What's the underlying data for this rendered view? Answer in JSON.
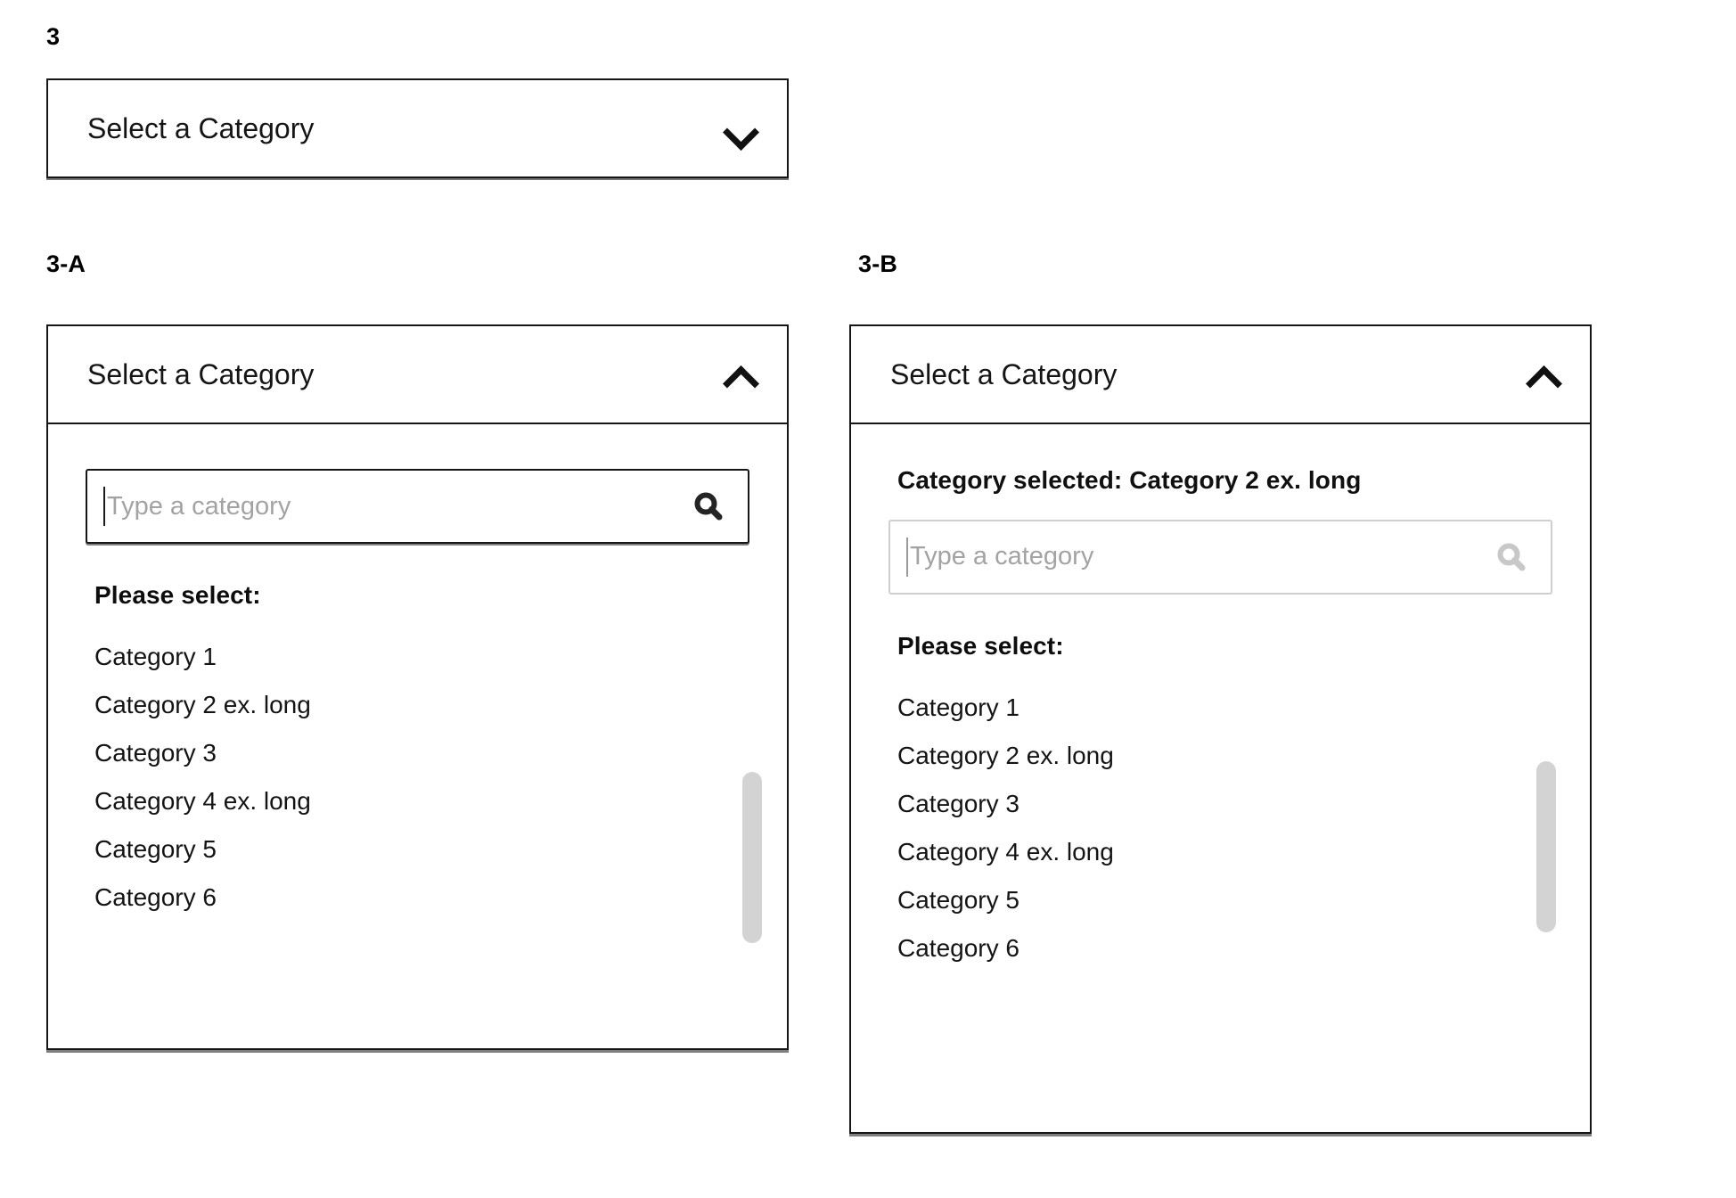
{
  "sections": {
    "collapsed": {
      "label": "3"
    },
    "variant_a": {
      "label": "3-A"
    },
    "variant_b": {
      "label": "3-B"
    }
  },
  "select_collapsed": {
    "placeholder": "Select a Category",
    "chevron_icon": "chevron-down-icon"
  },
  "dropdown_a": {
    "header_label": "Select a Category",
    "chevron_icon": "chevron-up-icon",
    "search": {
      "value": "",
      "placeholder": "Type a category",
      "icon": "search-icon",
      "state": "active",
      "border_color": "#161616",
      "icon_color": "#222222"
    },
    "list_heading": "Please select:",
    "categories": [
      "Category 1",
      "Category 2 ex. long",
      "Category 3",
      "Category 4 ex. long",
      "Category 5",
      "Category 6"
    ]
  },
  "dropdown_b": {
    "header_label": "Select a Category",
    "chevron_icon": "chevron-up-icon",
    "selected_notice": "Category selected: Category 2 ex. long",
    "search": {
      "value": "",
      "placeholder": "Type a category",
      "icon": "search-icon",
      "state": "muted",
      "border_color": "#cfcfcf",
      "icon_color": "#c8c8c8"
    },
    "list_heading": "Please select:",
    "categories": [
      "Category 1",
      "Category 2 ex. long",
      "Category 3",
      "Category 4 ex. long",
      "Category 5",
      "Category 6"
    ]
  },
  "colors": {
    "background": "#ffffff",
    "text": "#141414",
    "border_strong": "#161616",
    "border_muted": "#cfcfcf",
    "placeholder": "#a3a3a3",
    "scrollbar_thumb": "#d3d3d3"
  }
}
